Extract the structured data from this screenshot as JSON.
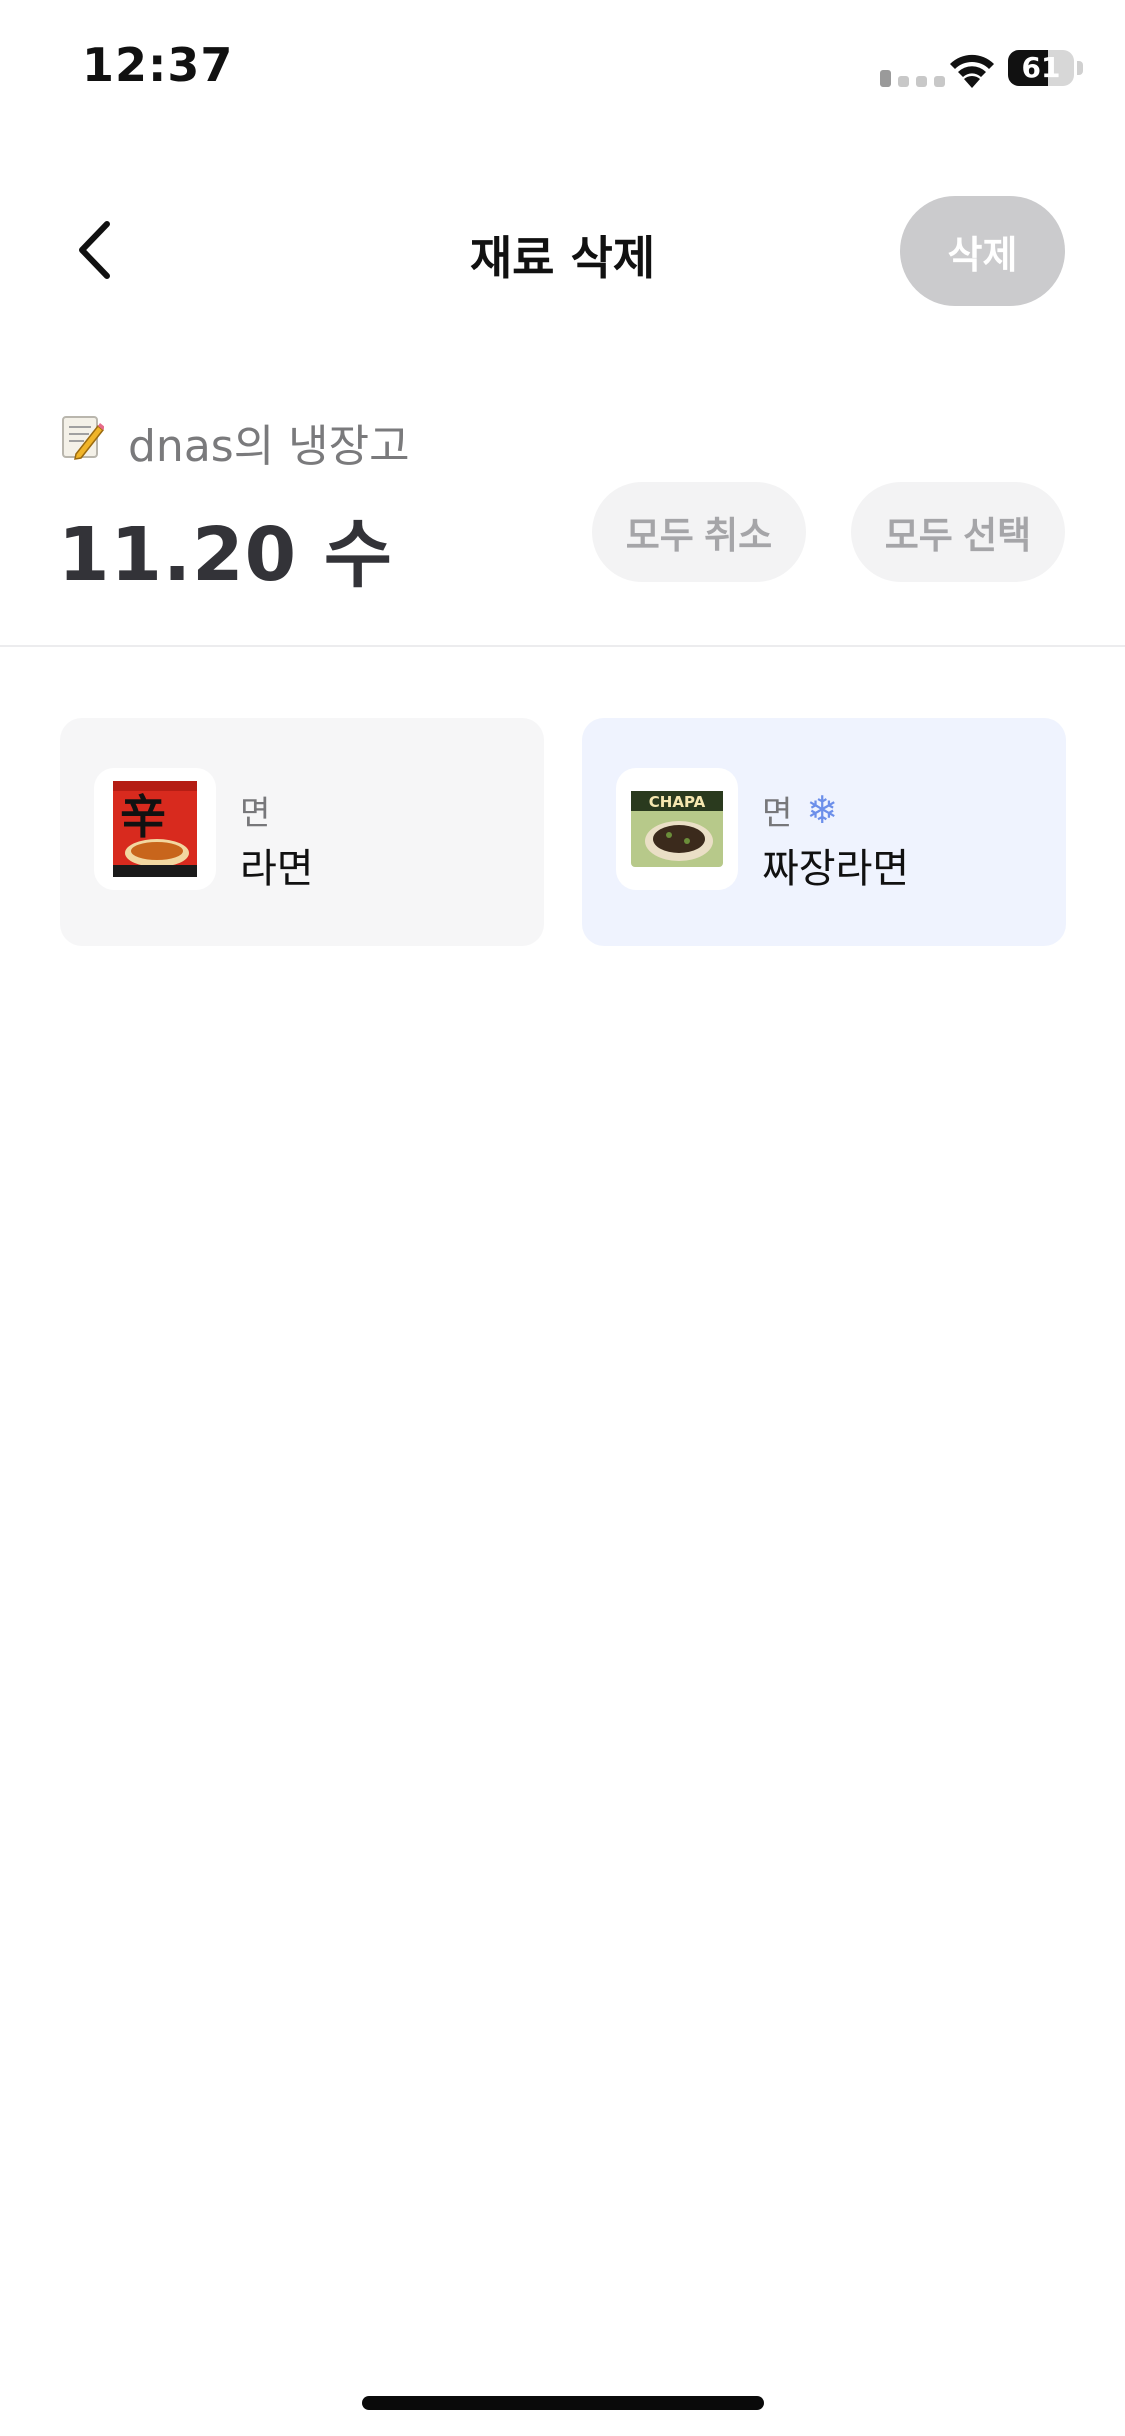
{
  "status_bar": {
    "time": "12:37",
    "battery": "61",
    "battery_level": 0.61
  },
  "nav": {
    "title": "재료 삭제",
    "delete_label": "삭제"
  },
  "fridge": {
    "name": "dnas의 냉장고",
    "count": "11.20 수"
  },
  "actions": {
    "deselect_all": "모두 취소",
    "select_all": "모두 선택"
  },
  "items": [
    {
      "category": "면",
      "name": "라면",
      "frozen": false,
      "image": "shin-ramyun-package"
    },
    {
      "category": "면",
      "name": "짜장라면",
      "frozen": true,
      "image": "chapagetti-package"
    }
  ],
  "icons": {
    "back": "chevron-left-icon",
    "memo": "memo-pencil-icon",
    "frozen": "snowflake-icon"
  },
  "colors": {
    "accent_selected_card": "#eff3fe",
    "snowflake": "#6c8fea",
    "disabled_button": "#cbcbcd"
  }
}
